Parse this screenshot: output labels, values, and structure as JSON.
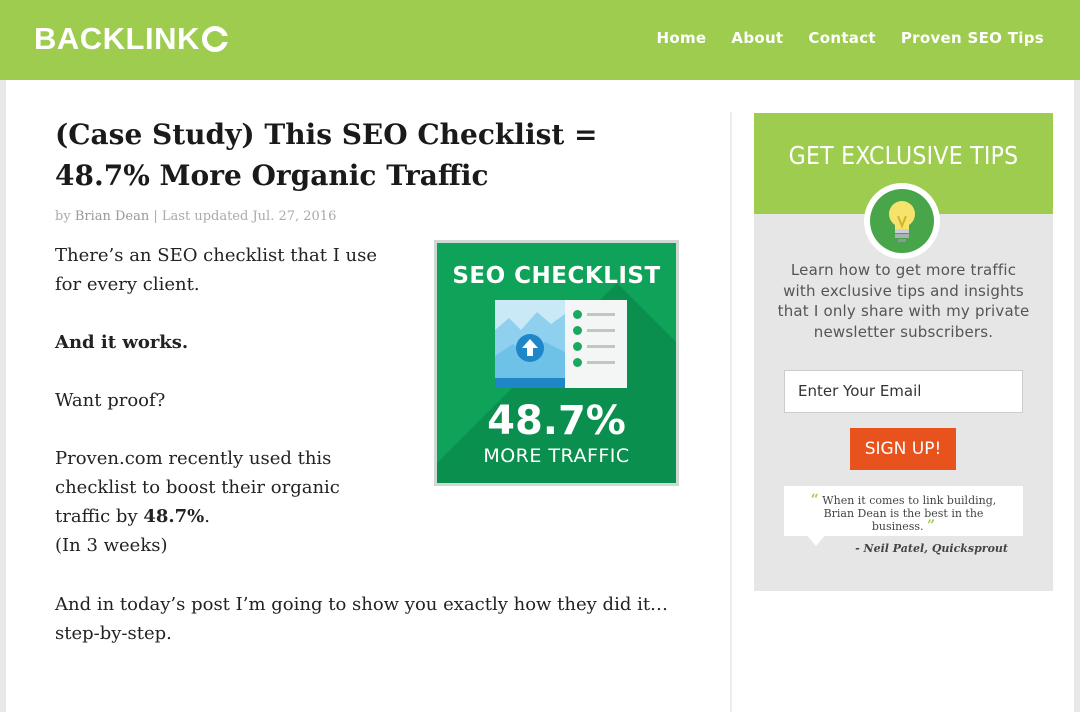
{
  "brand": {
    "logo_text": "BACKLINK",
    "accent": "#9ecc4f"
  },
  "nav": [
    {
      "label": "Home"
    },
    {
      "label": "About"
    },
    {
      "label": "Contact"
    },
    {
      "label": "Proven SEO Tips"
    }
  ],
  "article": {
    "title": "(Case Study) This SEO Checklist = 48.7% More Organic Traffic",
    "meta": {
      "by": "by",
      "author": "Brian Dean",
      "separator": "|",
      "updated": "Last updated Jul. 27, 2016"
    },
    "p1": "There’s an SEO checklist that I use for every client.",
    "p2": "And it works.",
    "p3": "Want proof?",
    "p4_pre": "Proven.com recently used this checklist to boost their organic traffic by ",
    "p4_bold": "48.7%",
    "p4_post": ".",
    "p5": "(In 3 weeks)",
    "p6": "And in today’s post I’m going to show you exactly how they did it…step-by-step."
  },
  "featured_image": {
    "title": "SEO CHECKLIST",
    "percent": "48.7%",
    "subtitle": "MORE TRAFFIC",
    "bg_color": "#0fa35a"
  },
  "sidebar": {
    "heading": "GET EXCLUSIVE TIPS",
    "icon": "lightbulb-icon",
    "text": "Learn how to get more traffic with exclusive tips and insights that I only share with my private newsletter subscribers.",
    "email_placeholder": "Enter Your Email",
    "button": "SIGN UP!",
    "button_color": "#e8521d",
    "quote": "When it comes to link building, Brian Dean is the best in the business.",
    "quote_author": "- Neil Patel, Quicksprout"
  }
}
